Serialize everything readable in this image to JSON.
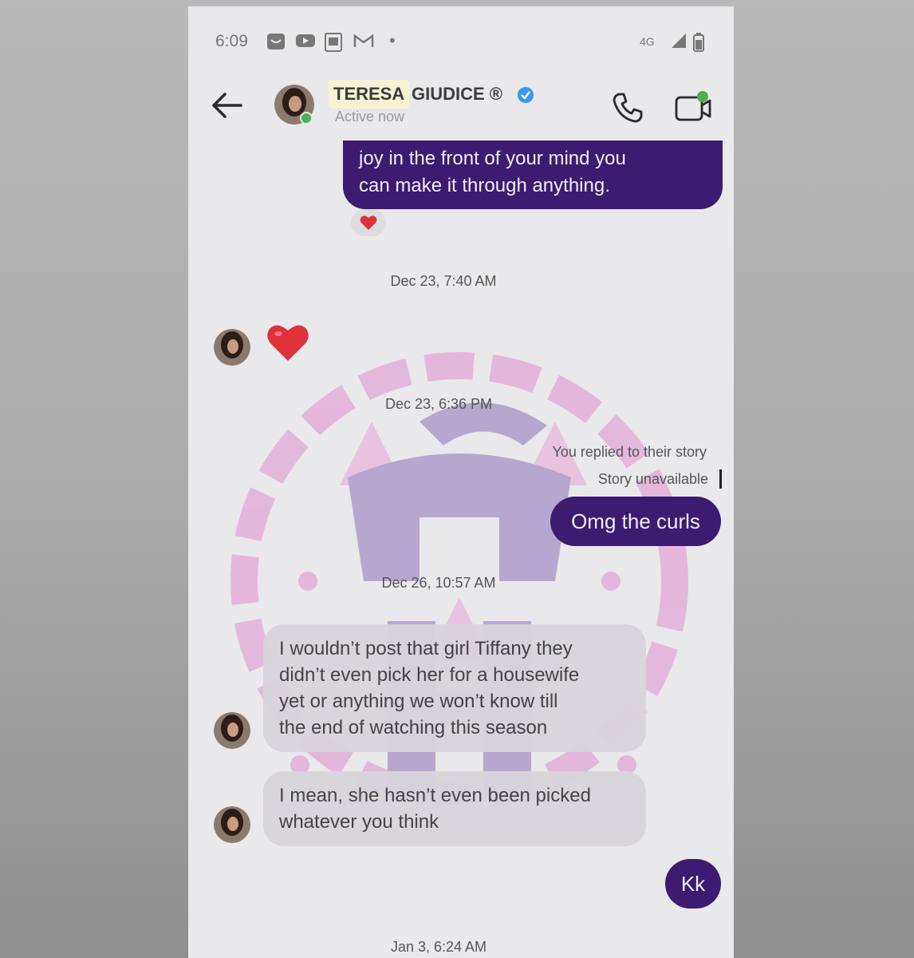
{
  "status_bar": {
    "time": "6:09",
    "icons": [
      "notification-icon",
      "youtube-icon",
      "gallery-icon",
      "gmail-icon",
      "dot-icon",
      "signal-icon",
      "battery-icon"
    ]
  },
  "header": {
    "contact_first": "TERESA",
    "contact_rest": "GIUDICE ®",
    "status": "Active now"
  },
  "messages": {
    "outgoing_1": {
      "line1": "joy in the front of your mind you",
      "line2": "can make it through anything."
    },
    "reaction_1": "heart",
    "ts_1": "Dec 23, 7:40 AM",
    "heart_message": "heart",
    "ts_2": "Dec 23, 6:36 PM",
    "reply_label": "You replied to their story",
    "story_unavailable": "Story unavailable",
    "outgoing_2": "Omg the curls",
    "ts_3": "Dec 26, 10:57 AM",
    "incoming_1": {
      "line1": "I wouldn’t post that girl Tiffany they",
      "line2": "didn’t even pick her for a housewife",
      "line3": "yet or anything we won’t know till",
      "line4": "the end of watching this season"
    },
    "incoming_2": {
      "line1": "I mean, she hasn’t even been picked",
      "line2": "whatever you think"
    },
    "outgoing_3": "Kk",
    "ts_4": "Jan 3, 6:24 AM"
  },
  "colors": {
    "outgoing_bubble": "#3c1b70",
    "incoming_bubble": "#d8d5da",
    "name_highlight": "#f7f2d2",
    "online": "#4caf50",
    "verified": "#3897f0",
    "heart": "#e0303a"
  }
}
